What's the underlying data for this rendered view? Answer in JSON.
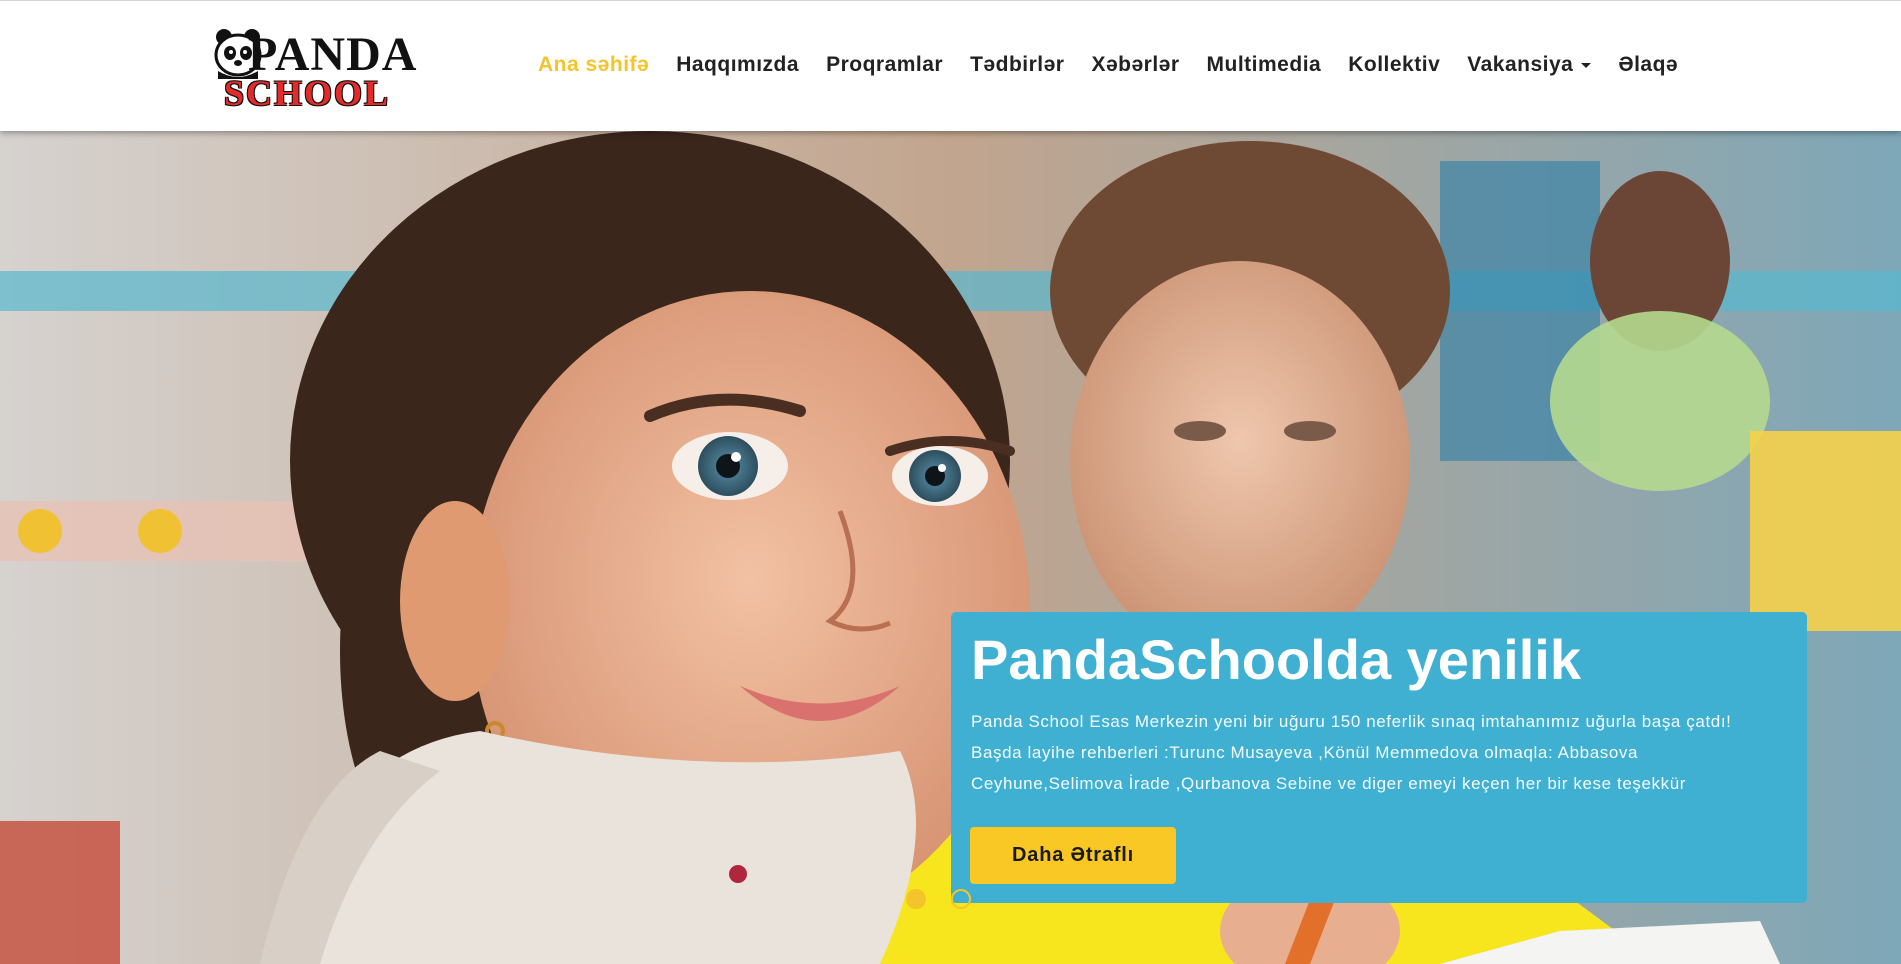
{
  "logo": {
    "line1": "PANDA",
    "line2": "SCHOOL"
  },
  "nav": {
    "items": [
      {
        "label": "Ana səhifə"
      },
      {
        "label": "Haqqımızda"
      },
      {
        "label": "Proqramlar"
      },
      {
        "label": "Tədbirlər"
      },
      {
        "label": "Xəbərlər"
      },
      {
        "label": "Multimedia"
      },
      {
        "label": "Kollektiv"
      },
      {
        "label": "Vakansiya"
      },
      {
        "label": "Əlaqə"
      }
    ],
    "active_index": 0
  },
  "hero": {
    "caption_title": "PandaSchoolda yenilik",
    "caption_text": "Panda School Esas Merkezin yeni bir uğuru 150 neferlik sınaq imtahanımız uğurla başa çatdı! Başda layihe rehberleri :Turunc Musayeva ,Könül Memmedova olmaqla: Abbasova Ceyhune,Selimova İrade ,Qurbanova Sebine ve diger emeyi keçen her bir kese teşekkür",
    "button_label": "Daha Ətraflı",
    "slides_count": 2,
    "active_slide": 0
  },
  "colors": {
    "accent_yellow": "#f5c32a",
    "caption_bg": "#3fb0d1",
    "logo_red": "#e52a2a"
  }
}
